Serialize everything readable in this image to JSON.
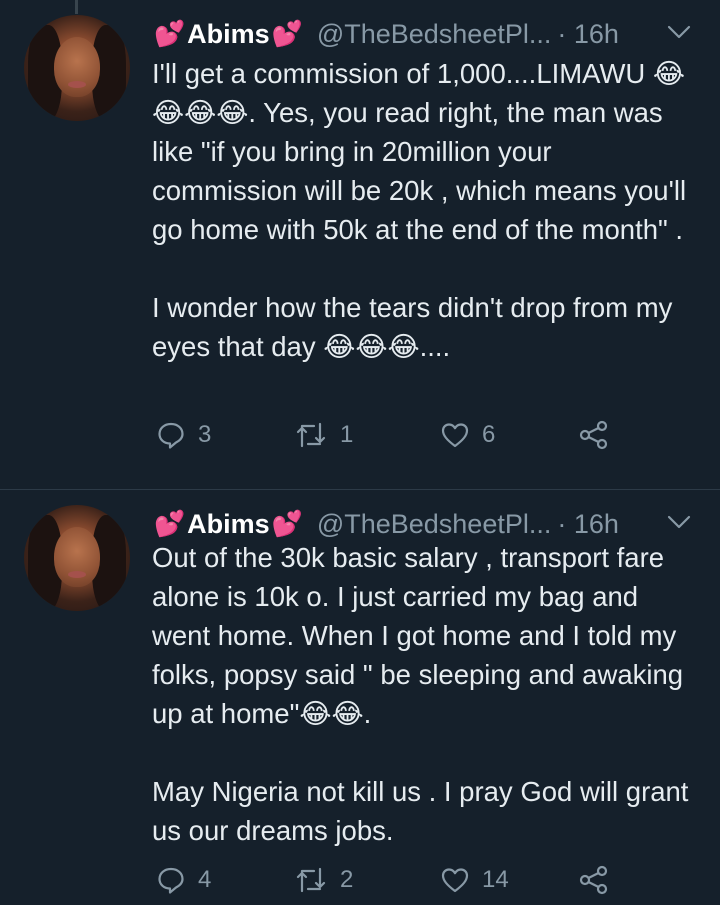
{
  "tweets": [
    {
      "display_name": "Abims",
      "name_prefix_emoji": "💕",
      "name_suffix_emoji": "💕",
      "handle": "@TheBedsheetPl...",
      "time": "· 16h",
      "text": "I'll get a commission of 1,000....LIMAWU 😂😂😂😂. Yes, you read right, the man was like \"if you bring in 20million your commission will be 20k , which means you'll go home with 50k at the end of the month\" .\n\nI wonder how the tears didn't drop from my eyes that day 😂😂😂....",
      "replies": "3",
      "retweets": "1",
      "likes": "6"
    },
    {
      "display_name": "Abims",
      "name_prefix_emoji": "💕",
      "name_suffix_emoji": "💕",
      "handle": "@TheBedsheetPl...",
      "time": "· 16h",
      "text": "Out of the 30k basic salary , transport fare alone is 10k o. I just carried my bag and went home. When I got home and I told my folks, popsy said \" be sleeping and awaking up at home\"😂😂.\n\nMay Nigeria not kill us . I pray God will grant  us our dreams jobs.",
      "replies": "4",
      "retweets": "2",
      "likes": "14"
    }
  ],
  "icons": {
    "reply": "reply-icon",
    "retweet": "retweet-icon",
    "like": "heart-icon",
    "share": "share-icon",
    "menu": "chevron-down-icon"
  },
  "colors": {
    "background": "#15202b",
    "text": "#e6ecf0",
    "secondary": "#8899a6",
    "heart_emoji": "#e0245e"
  }
}
